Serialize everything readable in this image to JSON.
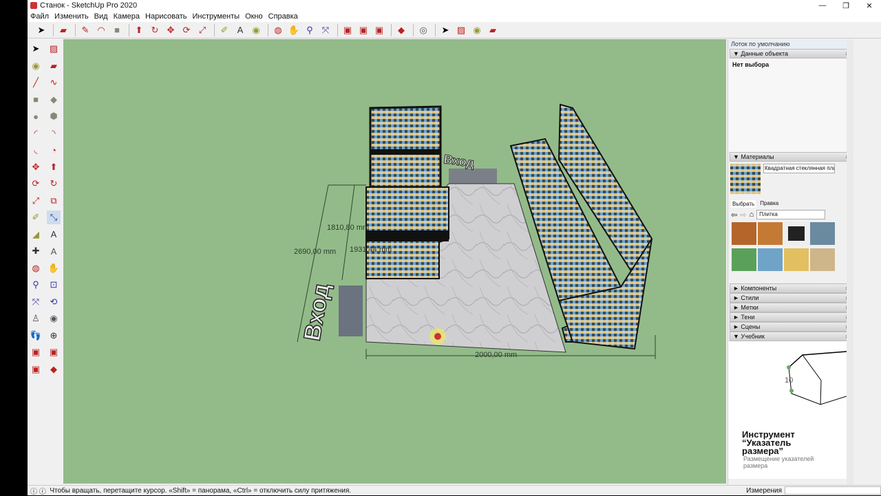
{
  "window": {
    "title": "Станок - SketchUp Pro 2020"
  },
  "menu": [
    "Файл",
    "Изменить",
    "Вид",
    "Камера",
    "Нарисовать",
    "Инструменты",
    "Окно",
    "Справка"
  ],
  "viewport": {
    "dimensions": {
      "width": "2000,00 mm",
      "height_total": "2690,00 mm",
      "height_a": "1810,80 mm",
      "height_b": "1931,44 mm"
    },
    "labels": {
      "entrance_front": "Вход",
      "entrance_back": "Вход"
    },
    "bg_color": "#93bb89"
  },
  "tray": {
    "title": "Лоток по умолчанию",
    "entity_info": {
      "header": "Данные объекта",
      "text": "Нет выбора"
    },
    "materials": {
      "header": "Материалы",
      "name": "Квадратная стеклянная плитка",
      "tab_select": "Выбрать",
      "tab_edit": "Правка",
      "collection": "Плитка"
    },
    "collapsed": [
      "Компоненты",
      "Стили",
      "Метки",
      "Тени",
      "Сцены"
    ],
    "instructor": {
      "header": "Учебник",
      "title": "Инструмент “Указатель размера”",
      "desc": "Размещение указателей размера",
      "figure_label": "10"
    }
  },
  "status": {
    "hint": "Чтобы вращать, перетащите курсор. «Shift» = панорама, «Ctrl» = отключить силу притяжения.",
    "measure_label": "Измерения",
    "measure_value": ""
  }
}
